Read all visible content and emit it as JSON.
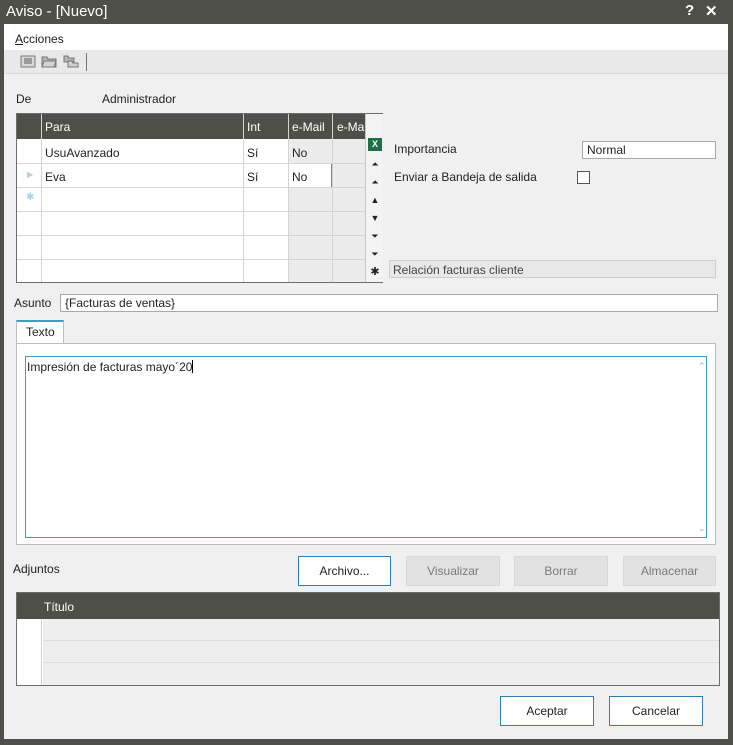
{
  "window": {
    "title": "Aviso - [Nuevo]",
    "help_glyph": "?",
    "close_glyph": "✕"
  },
  "menu": {
    "acciones_first": "A",
    "acciones_rest": "cciones"
  },
  "toolbar": {
    "icons": [
      "save-icon",
      "open-folder-icon",
      "folder-tree-icon"
    ]
  },
  "from": {
    "label": "De",
    "value": "Administrador"
  },
  "recipients": {
    "columns": [
      "Para",
      "Int",
      "e-Mail",
      "e-Ma"
    ],
    "rows": [
      {
        "para": "UsuAvanzado",
        "int": "Sí",
        "email": "No"
      },
      {
        "para": "Eva",
        "int": "Sí",
        "email": "No"
      }
    ],
    "excel_glyph": "X"
  },
  "importance": {
    "label": "Importancia",
    "value": "Normal"
  },
  "outbox": {
    "label": "Enviar a Bandeja de salida",
    "checked": false
  },
  "relation": {
    "value": "Relación facturas cliente"
  },
  "subject": {
    "label": "Asunto",
    "value": "{Facturas de ventas}"
  },
  "tabs": {
    "texto": "Texto"
  },
  "body": {
    "text": "Impresión de facturas mayo´20"
  },
  "attachments": {
    "label": "Adjuntos",
    "buttons": {
      "archivo": "Archivo...",
      "visualizar": "Visualizar",
      "borrar": "Borrar",
      "almacenar": "Almacenar"
    },
    "columns": [
      "Título"
    ]
  },
  "footer": {
    "accept": "Aceptar",
    "cancel": "Cancelar"
  }
}
